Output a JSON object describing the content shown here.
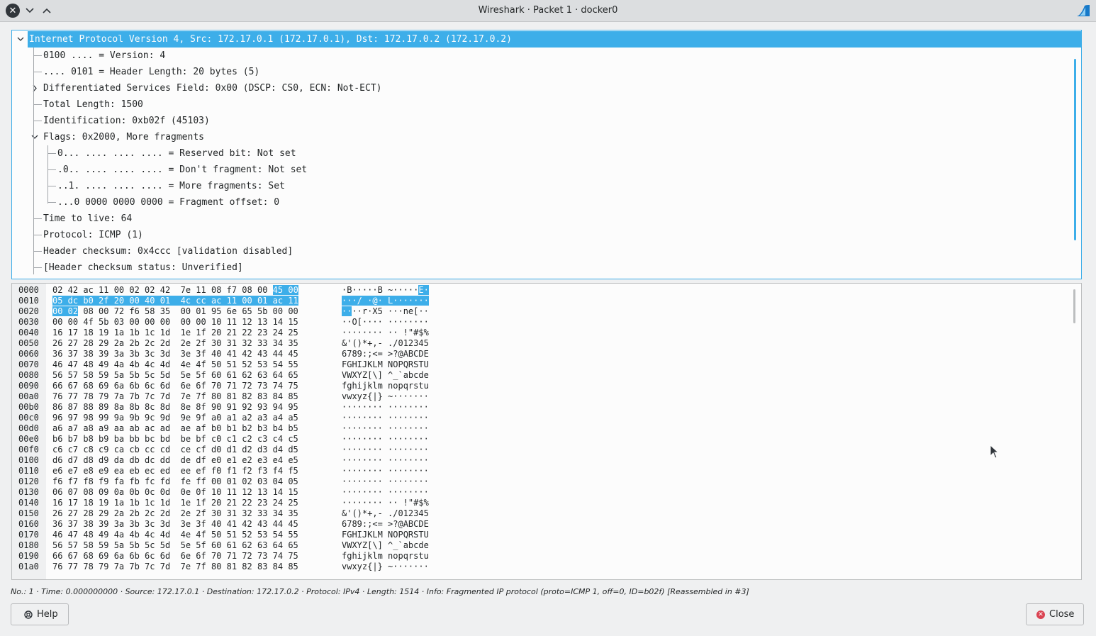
{
  "window": {
    "title": "Wireshark · Packet 1 · docker0"
  },
  "tree": {
    "rows": [
      {
        "text": "Internet Protocol Version 4, Src: 172.17.0.1 (172.17.0.1), Dst: 172.17.0.2 (172.17.0.2)",
        "selected": true,
        "expander": "down"
      },
      {
        "text": "0100 .... = Version: 4"
      },
      {
        "text": ".... 0101 = Header Length: 20 bytes (5)"
      },
      {
        "text": "Differentiated Services Field: 0x00 (DSCP: CS0, ECN: Not-ECT)",
        "expander": "right"
      },
      {
        "text": "Total Length: 1500"
      },
      {
        "text": "Identification: 0xb02f (45103)"
      },
      {
        "text": "Flags: 0x2000, More fragments",
        "expander": "down"
      },
      {
        "text": "0... .... .... .... = Reserved bit: Not set"
      },
      {
        "text": ".0.. .... .... .... = Don't fragment: Not set"
      },
      {
        "text": "..1. .... .... .... = More fragments: Set"
      },
      {
        "text": "...0 0000 0000 0000 = Fragment offset: 0"
      },
      {
        "text": "Time to live: 64"
      },
      {
        "text": "Protocol: ICMP (1)"
      },
      {
        "text": "Header checksum: 0x4ccc [validation disabled]"
      },
      {
        "text": "[Header checksum status: Unverified]"
      }
    ]
  },
  "hex": {
    "rows": [
      {
        "offset": "0000",
        "bytes": "02 42 ac 11 00 02 02 42  7e 11 08 f7 08 00 45 00",
        "ascii": "·B·····B ~·····E·"
      },
      {
        "offset": "0010",
        "bytes": "05 dc b0 2f 20 00 40 01  4c cc ac 11 00 01 ac 11",
        "ascii": "···/ ·@· L·······"
      },
      {
        "offset": "0020",
        "bytes": "00 02 08 00 72 f6 58 35  00 01 95 6e 65 5b 00 00",
        "ascii": "····r·X5 ···ne[··"
      },
      {
        "offset": "0030",
        "bytes": "00 00 4f 5b 03 00 00 00  00 00 10 11 12 13 14 15",
        "ascii": "··O[···· ········"
      },
      {
        "offset": "0040",
        "bytes": "16 17 18 19 1a 1b 1c 1d  1e 1f 20 21 22 23 24 25",
        "ascii": "········ ·· !\"#$%"
      },
      {
        "offset": "0050",
        "bytes": "26 27 28 29 2a 2b 2c 2d  2e 2f 30 31 32 33 34 35",
        "ascii": "&'()*+,- ./012345"
      },
      {
        "offset": "0060",
        "bytes": "36 37 38 39 3a 3b 3c 3d  3e 3f 40 41 42 43 44 45",
        "ascii": "6789:;<= >?@ABCDE"
      },
      {
        "offset": "0070",
        "bytes": "46 47 48 49 4a 4b 4c 4d  4e 4f 50 51 52 53 54 55",
        "ascii": "FGHIJKLM NOPQRSTU"
      },
      {
        "offset": "0080",
        "bytes": "56 57 58 59 5a 5b 5c 5d  5e 5f 60 61 62 63 64 65",
        "ascii": "VWXYZ[\\] ^_`abcde"
      },
      {
        "offset": "0090",
        "bytes": "66 67 68 69 6a 6b 6c 6d  6e 6f 70 71 72 73 74 75",
        "ascii": "fghijklm nopqrstu"
      },
      {
        "offset": "00a0",
        "bytes": "76 77 78 79 7a 7b 7c 7d  7e 7f 80 81 82 83 84 85",
        "ascii": "vwxyz{|} ~·······"
      },
      {
        "offset": "00b0",
        "bytes": "86 87 88 89 8a 8b 8c 8d  8e 8f 90 91 92 93 94 95",
        "ascii": "········ ········"
      },
      {
        "offset": "00c0",
        "bytes": "96 97 98 99 9a 9b 9c 9d  9e 9f a0 a1 a2 a3 a4 a5",
        "ascii": "········ ········"
      },
      {
        "offset": "00d0",
        "bytes": "a6 a7 a8 a9 aa ab ac ad  ae af b0 b1 b2 b3 b4 b5",
        "ascii": "········ ········"
      },
      {
        "offset": "00e0",
        "bytes": "b6 b7 b8 b9 ba bb bc bd  be bf c0 c1 c2 c3 c4 c5",
        "ascii": "········ ········"
      },
      {
        "offset": "00f0",
        "bytes": "c6 c7 c8 c9 ca cb cc cd  ce cf d0 d1 d2 d3 d4 d5",
        "ascii": "········ ········"
      },
      {
        "offset": "0100",
        "bytes": "d6 d7 d8 d9 da db dc dd  de df e0 e1 e2 e3 e4 e5",
        "ascii": "········ ········"
      },
      {
        "offset": "0110",
        "bytes": "e6 e7 e8 e9 ea eb ec ed  ee ef f0 f1 f2 f3 f4 f5",
        "ascii": "········ ········"
      },
      {
        "offset": "0120",
        "bytes": "f6 f7 f8 f9 fa fb fc fd  fe ff 00 01 02 03 04 05",
        "ascii": "········ ········"
      },
      {
        "offset": "0130",
        "bytes": "06 07 08 09 0a 0b 0c 0d  0e 0f 10 11 12 13 14 15",
        "ascii": "········ ········"
      },
      {
        "offset": "0140",
        "bytes": "16 17 18 19 1a 1b 1c 1d  1e 1f 20 21 22 23 24 25",
        "ascii": "········ ·· !\"#$%"
      },
      {
        "offset": "0150",
        "bytes": "26 27 28 29 2a 2b 2c 2d  2e 2f 30 31 32 33 34 35",
        "ascii": "&'()*+,- ./012345"
      },
      {
        "offset": "0160",
        "bytes": "36 37 38 39 3a 3b 3c 3d  3e 3f 40 41 42 43 44 45",
        "ascii": "6789:;<= >?@ABCDE"
      },
      {
        "offset": "0170",
        "bytes": "46 47 48 49 4a 4b 4c 4d  4e 4f 50 51 52 53 54 55",
        "ascii": "FGHIJKLM NOPQRSTU"
      },
      {
        "offset": "0180",
        "bytes": "56 57 58 59 5a 5b 5c 5d  5e 5f 60 61 62 63 64 65",
        "ascii": "VWXYZ[\\] ^_`abcde"
      },
      {
        "offset": "0190",
        "bytes": "66 67 68 69 6a 6b 6c 6d  6e 6f 70 71 72 73 74 75",
        "ascii": "fghijklm nopqrstu"
      },
      {
        "offset": "01a0",
        "bytes": "76 77 78 79 7a 7b 7c 7d  7e 7f 80 81 82 83 84 85",
        "ascii": "vwxyz{|} ~·······"
      }
    ]
  },
  "status": {
    "text": "No.: 1 · Time: 0.000000000 · Source: 172.17.0.1 · Destination: 172.17.0.2 · Protocol: IPv4 · Length: 1514 · Info: Fragmented IP protocol (proto=ICMP 1, off=0, ID=b02f) [Reassembled in #3]"
  },
  "buttons": {
    "help_label": "Help",
    "close_label": "Close"
  },
  "colors": {
    "accent": "#3daee9",
    "close_icon": "#da4453"
  }
}
